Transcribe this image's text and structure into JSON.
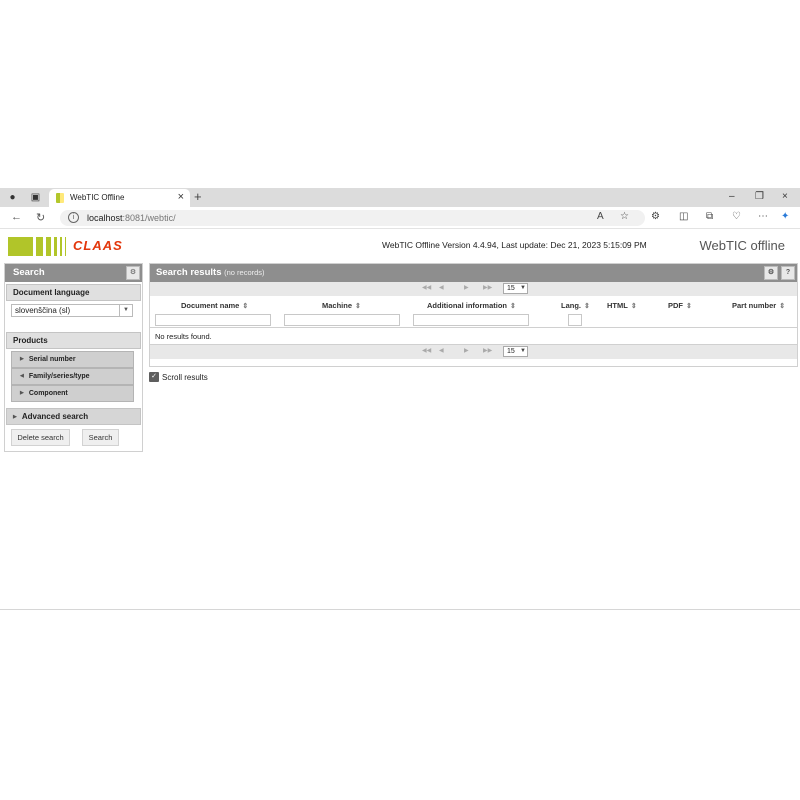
{
  "browser": {
    "tab_title": "WebTIC Offline",
    "url_host": "localhost",
    "url_rest": ":8081/webtic/"
  },
  "header": {
    "logo_word": "CLAAS",
    "version_text": "WebTIC Offline Version 4.4.94, Last update: Dec 21, 2023 5:15:09 PM",
    "brand_text": "WebTIC offline",
    "logo_color": "#b1c529",
    "logo_word_color": "#e3360b"
  },
  "search_panel": {
    "title": "Search",
    "document_language_label": "Document language",
    "language_value": "slovenščina (sl)",
    "products_label": "Products",
    "product_items": [
      {
        "label": "Serial number"
      },
      {
        "label": "Family/series/type"
      },
      {
        "label": "Component"
      }
    ],
    "advanced_search_label": "Advanced search",
    "delete_label": "Delete search",
    "search_label": "Search"
  },
  "results_panel": {
    "title": "Search results",
    "subtitle": "(no records)",
    "page_size": "15",
    "columns": [
      {
        "label": "Document name"
      },
      {
        "label": "Machine"
      },
      {
        "label": "Additional information"
      },
      {
        "label": "Lang."
      },
      {
        "label": "HTML"
      },
      {
        "label": "PDF"
      },
      {
        "label": "Part number"
      }
    ],
    "no_results_text": "No results found.",
    "scroll_results_label": "Scroll results",
    "scroll_results_checked": true
  }
}
